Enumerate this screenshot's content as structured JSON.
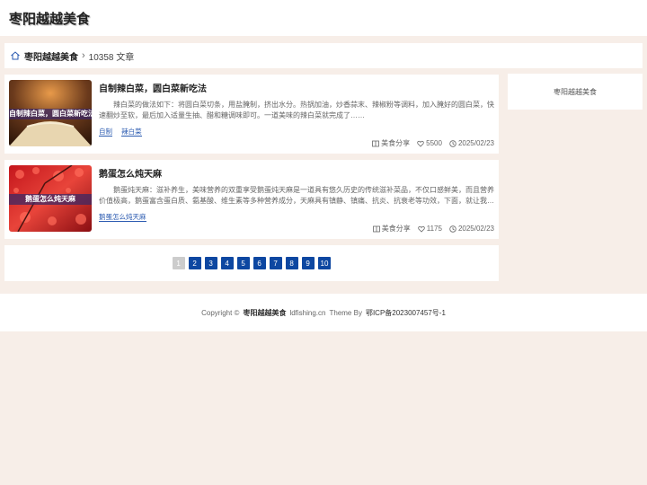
{
  "header": {
    "site_title": "枣阳越越美食"
  },
  "breadcrumb": {
    "home": "枣阳越越美食",
    "count": "10358 文章"
  },
  "articles": [
    {
      "title": "自制辣白菜，圆白菜新吃法",
      "thumb_caption": "自制辣白菜，圆白菜新吃法",
      "excerpt": "辣白菜的做法如下：将圆白菜切条，用盐腌制，挤出水分。热锅加油，炒香蒜末、辣椒粉等调料，加入腌好的圆白菜，快速翻炒至软，最后加入适量生抽、醋和糖调味即可。一道美味的辣白菜就完成了……",
      "tags": [
        "自制",
        "辣白菜"
      ],
      "category": "美食分享",
      "likes": "5500",
      "date": "2025/02/23"
    },
    {
      "title": "鹅蛋怎么炖天麻",
      "thumb_caption": "鹅蛋怎么炖天麻",
      "excerpt": "鹅蛋炖天麻：滋补养生，美味营养的双重享受鹅蛋炖天麻是一道具有悠久历史的传统滋补菜品，不仅口感鲜美，而且营养价值极高，鹅蛋富含蛋白质、氨基酸、维生素等多种营养成分，天麻具有镇静、镇痛、抗炎、抗衰老等功效，下面，就让我…",
      "tags": [
        "鹅蛋怎么炖天麻"
      ],
      "category": "美食分享",
      "likes": "1175",
      "date": "2025/02/23"
    }
  ],
  "pagination": {
    "pages": [
      "1",
      "2",
      "3",
      "4",
      "5",
      "6",
      "7",
      "8",
      "9",
      "10"
    ],
    "current": "1"
  },
  "sidebar": {
    "title": "枣阳越越美食"
  },
  "footer": {
    "copyright": "Copyright ©",
    "site": "枣阳越越美食",
    "domain": "ldfishing.cn",
    "theme": "Theme By",
    "icp": "鄂ICP备2023007457号-1"
  },
  "icons": {
    "home": "home-icon",
    "chevron": "chevron-right-icon",
    "category": "book-icon",
    "like": "heart-icon",
    "date": "clock-icon"
  },
  "colors": {
    "accent": "#0d47a1",
    "background": "#f7eee8"
  }
}
